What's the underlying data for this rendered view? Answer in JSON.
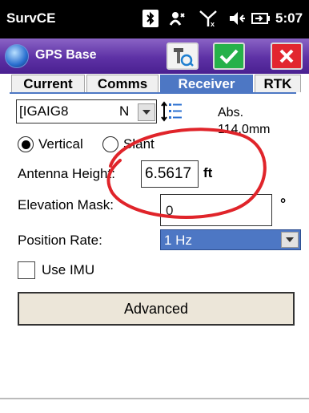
{
  "statusbar": {
    "app_name": "SurvCE",
    "time": "5:07",
    "icons": [
      "bluetooth-icon",
      "network-icon",
      "signal-icon",
      "volume-icon",
      "battery-icon"
    ]
  },
  "titlebar": {
    "title": "GPS Base",
    "buttons": [
      "antenna-settings-icon",
      "checkmark-icon",
      "close-icon"
    ]
  },
  "tabs": [
    {
      "label": "Current",
      "active": false
    },
    {
      "label": "Comms",
      "active": false
    },
    {
      "label": "Receiver",
      "active": true
    },
    {
      "label": "RTK",
      "active": false
    }
  ],
  "form": {
    "antenna_value": "[IGAIG8",
    "antenna_value_tail": "N",
    "abs_label": "Abs.",
    "abs_value": "114.0mm",
    "radio_vertical": "Vertical",
    "radio_slant": "Slant",
    "selected_measure": "Vertical",
    "antenna_height_label": "Antenna Height:",
    "antenna_height_value": "6.5617",
    "antenna_height_unit": "ft",
    "elevation_mask_label": "Elevation Mask:",
    "elevation_mask_value": "0",
    "elevation_mask_unit": "°",
    "position_rate_label": "Position Rate:",
    "position_rate_value": "1 Hz",
    "use_imu_label": "Use IMU",
    "use_imu_checked": false,
    "advanced_label": "Advanced"
  },
  "colors": {
    "titlebar": "#5d31a5",
    "tab_active": "#4d77c4",
    "ok_button": "#26b14a",
    "cancel_button": "#e2262f",
    "highlight_circle": "#e0242a"
  }
}
